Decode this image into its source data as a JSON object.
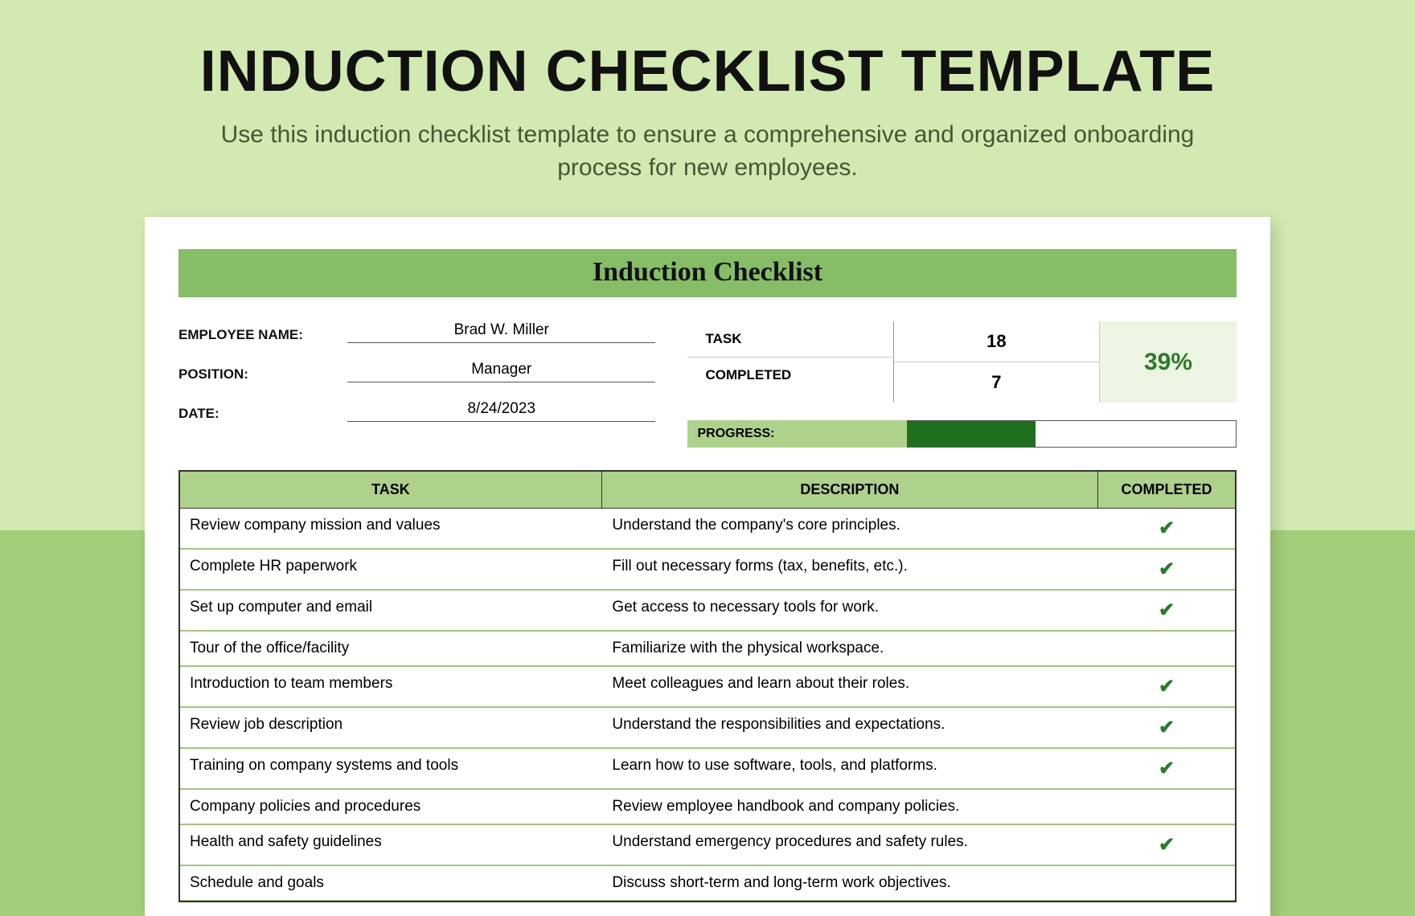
{
  "header": {
    "title": "INDUCTION CHECKLIST TEMPLATE",
    "subtitle": "Use this induction checklist template to ensure a comprehensive and organized onboarding process for new employees."
  },
  "banner": "Induction Checklist",
  "employee": {
    "name_label": "EMPLOYEE NAME:",
    "name": "Brad W. Miller",
    "position_label": "POSITION:",
    "position": "Manager",
    "date_label": "DATE:",
    "date": "8/24/2023"
  },
  "stats": {
    "task_label": "TASK",
    "task_count": "18",
    "completed_label": "COMPLETED",
    "completed_count": "7",
    "percent": "39%",
    "progress_label": "PROGRESS:",
    "progress_percent": 39
  },
  "columns": {
    "task": "TASK",
    "description": "DESCRIPTION",
    "completed": "COMPLETED"
  },
  "check_glyph": "✔",
  "tasks": [
    {
      "task": "Review company mission and values",
      "description": "Understand the company's core principles.",
      "completed": true
    },
    {
      "task": "Complete HR paperwork",
      "description": "Fill out necessary forms (tax, benefits, etc.).",
      "completed": true
    },
    {
      "task": "Set up computer and email",
      "description": "Get access to necessary tools for work.",
      "completed": true
    },
    {
      "task": "Tour of the office/facility",
      "description": "Familiarize with the physical workspace.",
      "completed": false
    },
    {
      "task": "Introduction to team members",
      "description": "Meet colleagues and learn about their roles.",
      "completed": true
    },
    {
      "task": "Review job description",
      "description": "Understand the responsibilities and expectations.",
      "completed": true
    },
    {
      "task": "Training on company systems and tools",
      "description": "Learn how to use software, tools, and platforms.",
      "completed": true
    },
    {
      "task": "Company policies and procedures",
      "description": "Review employee handbook and company policies.",
      "completed": false
    },
    {
      "task": "Health and safety guidelines",
      "description": "Understand emergency procedures and safety rules.",
      "completed": true
    },
    {
      "task": "Schedule and goals",
      "description": "Discuss short-term and long-term work objectives.",
      "completed": false
    }
  ]
}
